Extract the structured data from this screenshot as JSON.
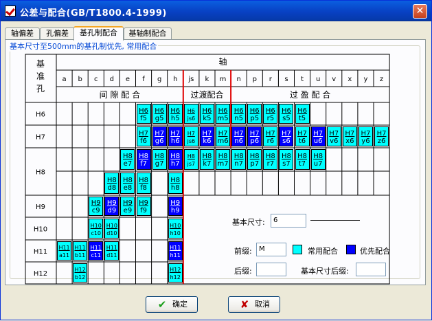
{
  "window": {
    "title": "公差与配合(GB/T1800.4-1999)",
    "close_label": "✕"
  },
  "tabs": [
    {
      "label": "轴偏差"
    },
    {
      "label": "孔偏差"
    },
    {
      "label": "基孔制配合",
      "active": true
    },
    {
      "label": "基轴制配合"
    }
  ],
  "group_label": "基本尺寸至500mm的基孔制优先, 常用配合",
  "table": {
    "corner": [
      "基",
      "准",
      "孔"
    ],
    "shaft_header": "轴",
    "shafts": [
      "a",
      "b",
      "c",
      "d",
      "e",
      "f",
      "g",
      "h",
      "js",
      "k",
      "m",
      "n",
      "p",
      "r",
      "s",
      "t",
      "u",
      "v",
      "x",
      "y",
      "z"
    ],
    "categories": [
      "间 隙 配 合",
      "过渡配合",
      "过 盈 配 合"
    ],
    "holes": [
      "H6",
      "H7",
      "H8",
      "H9",
      "H10",
      "H11",
      "H12"
    ],
    "colors": {
      "common": "#00ffff",
      "preferred": "#0000ff",
      "boundary": "#e00000"
    },
    "fits": [
      {
        "hole": "H6",
        "cells": [
          {
            "col": 5,
            "a": "H6",
            "b": "f5",
            "t": "common"
          },
          {
            "col": 6,
            "a": "H6",
            "b": "g5",
            "t": "common"
          },
          {
            "col": 7,
            "a": "H6",
            "b": "h5",
            "t": "common"
          },
          {
            "col": 8,
            "a": "H6",
            "b": "js6",
            "t": "common"
          },
          {
            "col": 9,
            "a": "H6",
            "b": "k5",
            "t": "common"
          },
          {
            "col": 10,
            "a": "H6",
            "b": "m5",
            "t": "common"
          },
          {
            "col": 11,
            "a": "H6",
            "b": "n5",
            "t": "common"
          },
          {
            "col": 12,
            "a": "H6",
            "b": "p5",
            "t": "common"
          },
          {
            "col": 13,
            "a": "H6",
            "b": "r5",
            "t": "common"
          },
          {
            "col": 14,
            "a": "H6",
            "b": "s5",
            "t": "common"
          },
          {
            "col": 15,
            "a": "H6",
            "b": "t5",
            "t": "common"
          }
        ]
      },
      {
        "hole": "H7",
        "cells": [
          {
            "col": 5,
            "a": "H7",
            "b": "f6",
            "t": "common"
          },
          {
            "col": 6,
            "a": "H7",
            "b": "g6",
            "t": "preferred"
          },
          {
            "col": 7,
            "a": "H7",
            "b": "h6",
            "t": "preferred"
          },
          {
            "col": 8,
            "a": "H7",
            "b": "js6",
            "t": "common"
          },
          {
            "col": 9,
            "a": "H7",
            "b": "k6",
            "t": "preferred"
          },
          {
            "col": 10,
            "a": "H7",
            "b": "m6",
            "t": "common"
          },
          {
            "col": 11,
            "a": "H7",
            "b": "n6",
            "t": "preferred"
          },
          {
            "col": 12,
            "a": "H7",
            "b": "p6",
            "t": "preferred"
          },
          {
            "col": 13,
            "a": "H7",
            "b": "r6",
            "t": "common"
          },
          {
            "col": 14,
            "a": "H7",
            "b": "s6",
            "t": "preferred"
          },
          {
            "col": 15,
            "a": "H7",
            "b": "t6",
            "t": "common"
          },
          {
            "col": 16,
            "a": "H7",
            "b": "u6",
            "t": "preferred"
          },
          {
            "col": 17,
            "a": "H7",
            "b": "v6",
            "t": "common"
          },
          {
            "col": 18,
            "a": "H7",
            "b": "x6",
            "t": "common"
          },
          {
            "col": 19,
            "a": "H7",
            "b": "y6",
            "t": "common"
          },
          {
            "col": 20,
            "a": "H7",
            "b": "z6",
            "t": "common"
          }
        ]
      },
      {
        "hole": "H8",
        "cells": [
          {
            "col": 4,
            "a": "H8",
            "b": "e7",
            "t": "common"
          },
          {
            "col": 5,
            "a": "H8",
            "b": "f7",
            "t": "preferred"
          },
          {
            "col": 6,
            "a": "H8",
            "b": "g7",
            "t": "common"
          },
          {
            "col": 7,
            "a": "H8",
            "b": "h7",
            "t": "preferred"
          },
          {
            "col": 8,
            "a": "H8",
            "b": "js7",
            "t": "common"
          },
          {
            "col": 9,
            "a": "H8",
            "b": "k7",
            "t": "common"
          },
          {
            "col": 10,
            "a": "H8",
            "b": "m7",
            "t": "common"
          },
          {
            "col": 11,
            "a": "H8",
            "b": "n7",
            "t": "common"
          },
          {
            "col": 12,
            "a": "H8",
            "b": "p7",
            "t": "common"
          },
          {
            "col": 13,
            "a": "H8",
            "b": "r7",
            "t": "common"
          },
          {
            "col": 14,
            "a": "H8",
            "b": "s7",
            "t": "common"
          },
          {
            "col": 15,
            "a": "H8",
            "b": "t7",
            "t": "common"
          },
          {
            "col": 16,
            "a": "H8",
            "b": "u7",
            "t": "common"
          },
          {
            "col": 3,
            "a": "H8",
            "b": "d8",
            "t": "common",
            "sub": 1
          },
          {
            "col": 4,
            "a": "H8",
            "b": "e8",
            "t": "common",
            "sub": 1
          },
          {
            "col": 5,
            "a": "H8",
            "b": "f8",
            "t": "common",
            "sub": 1
          },
          {
            "col": 7,
            "a": "H8",
            "b": "h8",
            "t": "common",
            "sub": 1
          }
        ]
      },
      {
        "hole": "H9",
        "cells": [
          {
            "col": 2,
            "a": "H9",
            "b": "c9",
            "t": "common"
          },
          {
            "col": 3,
            "a": "H9",
            "b": "d9",
            "t": "preferred"
          },
          {
            "col": 4,
            "a": "H9",
            "b": "e9",
            "t": "common"
          },
          {
            "col": 5,
            "a": "H9",
            "b": "f9",
            "t": "common"
          },
          {
            "col": 7,
            "a": "H9",
            "b": "h9",
            "t": "preferred"
          }
        ]
      },
      {
        "hole": "H10",
        "cells": [
          {
            "col": 2,
            "a": "H10",
            "b": "c10",
            "t": "common"
          },
          {
            "col": 3,
            "a": "H10",
            "b": "d10",
            "t": "common"
          },
          {
            "col": 7,
            "a": "H10",
            "b": "h10",
            "t": "common"
          }
        ]
      },
      {
        "hole": "H11",
        "cells": [
          {
            "col": 0,
            "a": "H11",
            "b": "a11",
            "t": "common"
          },
          {
            "col": 1,
            "a": "H11",
            "b": "b11",
            "t": "common"
          },
          {
            "col": 2,
            "a": "H11",
            "b": "c11",
            "t": "preferred"
          },
          {
            "col": 3,
            "a": "H11",
            "b": "d11",
            "t": "common"
          },
          {
            "col": 7,
            "a": "H11",
            "b": "h11",
            "t": "preferred"
          }
        ]
      },
      {
        "hole": "H12",
        "cells": [
          {
            "col": 1,
            "a": "H12",
            "b": "b12",
            "t": "common"
          },
          {
            "col": 7,
            "a": "H12",
            "b": "h12",
            "t": "common"
          }
        ]
      }
    ]
  },
  "form": {
    "basic_size_label": "基本尺寸:",
    "basic_size_value": "6",
    "prefix_label": "前缀:",
    "prefix_value": "M",
    "suffix_label": "后缀:",
    "suffix_value": "",
    "size_suffix_label": "基本尺寸后缀:",
    "size_suffix_value": "",
    "legend_common": "常用配合",
    "legend_preferred": "优先配合"
  },
  "buttons": {
    "ok": "确定",
    "cancel": "取消"
  }
}
